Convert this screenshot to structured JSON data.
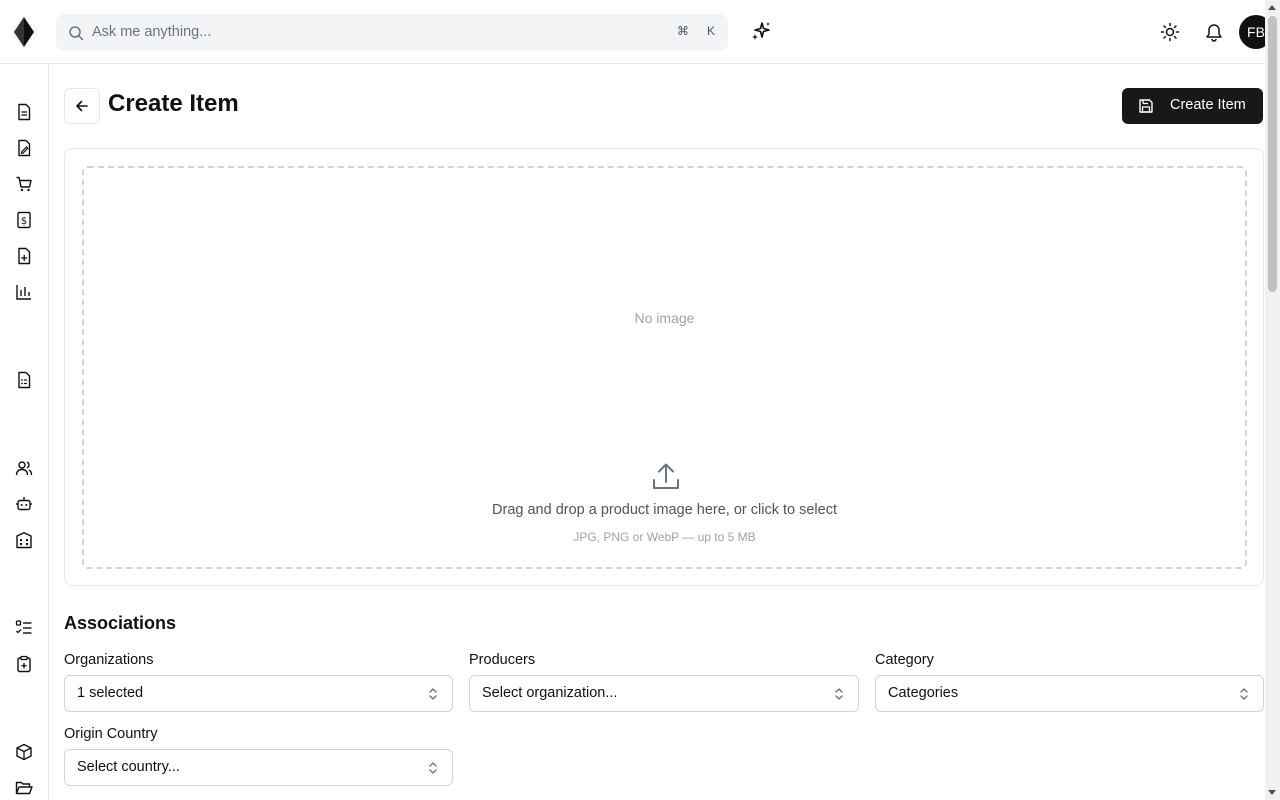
{
  "search": {
    "placeholder": "Ask me anything...",
    "shortcut_mod": "⌘",
    "shortcut_key": "K"
  },
  "user": {
    "initials": "FB"
  },
  "header": {
    "title": "Create Item",
    "create_label": "Create Item"
  },
  "image_upload": {
    "empty_text": "No image",
    "instruction": "Drag and drop a product image here, or click to select",
    "hint": "JPG, PNG or WebP — up to 5 MB"
  },
  "associations": {
    "title": "Associations",
    "organizations": {
      "label": "Organizations",
      "value": "1 selected"
    },
    "producers": {
      "label": "Producers",
      "value": "Select organization..."
    },
    "category": {
      "label": "Category",
      "value": "Categories"
    },
    "origin_country": {
      "label": "Origin Country",
      "value": "Select country..."
    }
  },
  "colors": {
    "primary": "#18181b",
    "border": "#e5e7eb",
    "muted": "#9ca3af"
  }
}
